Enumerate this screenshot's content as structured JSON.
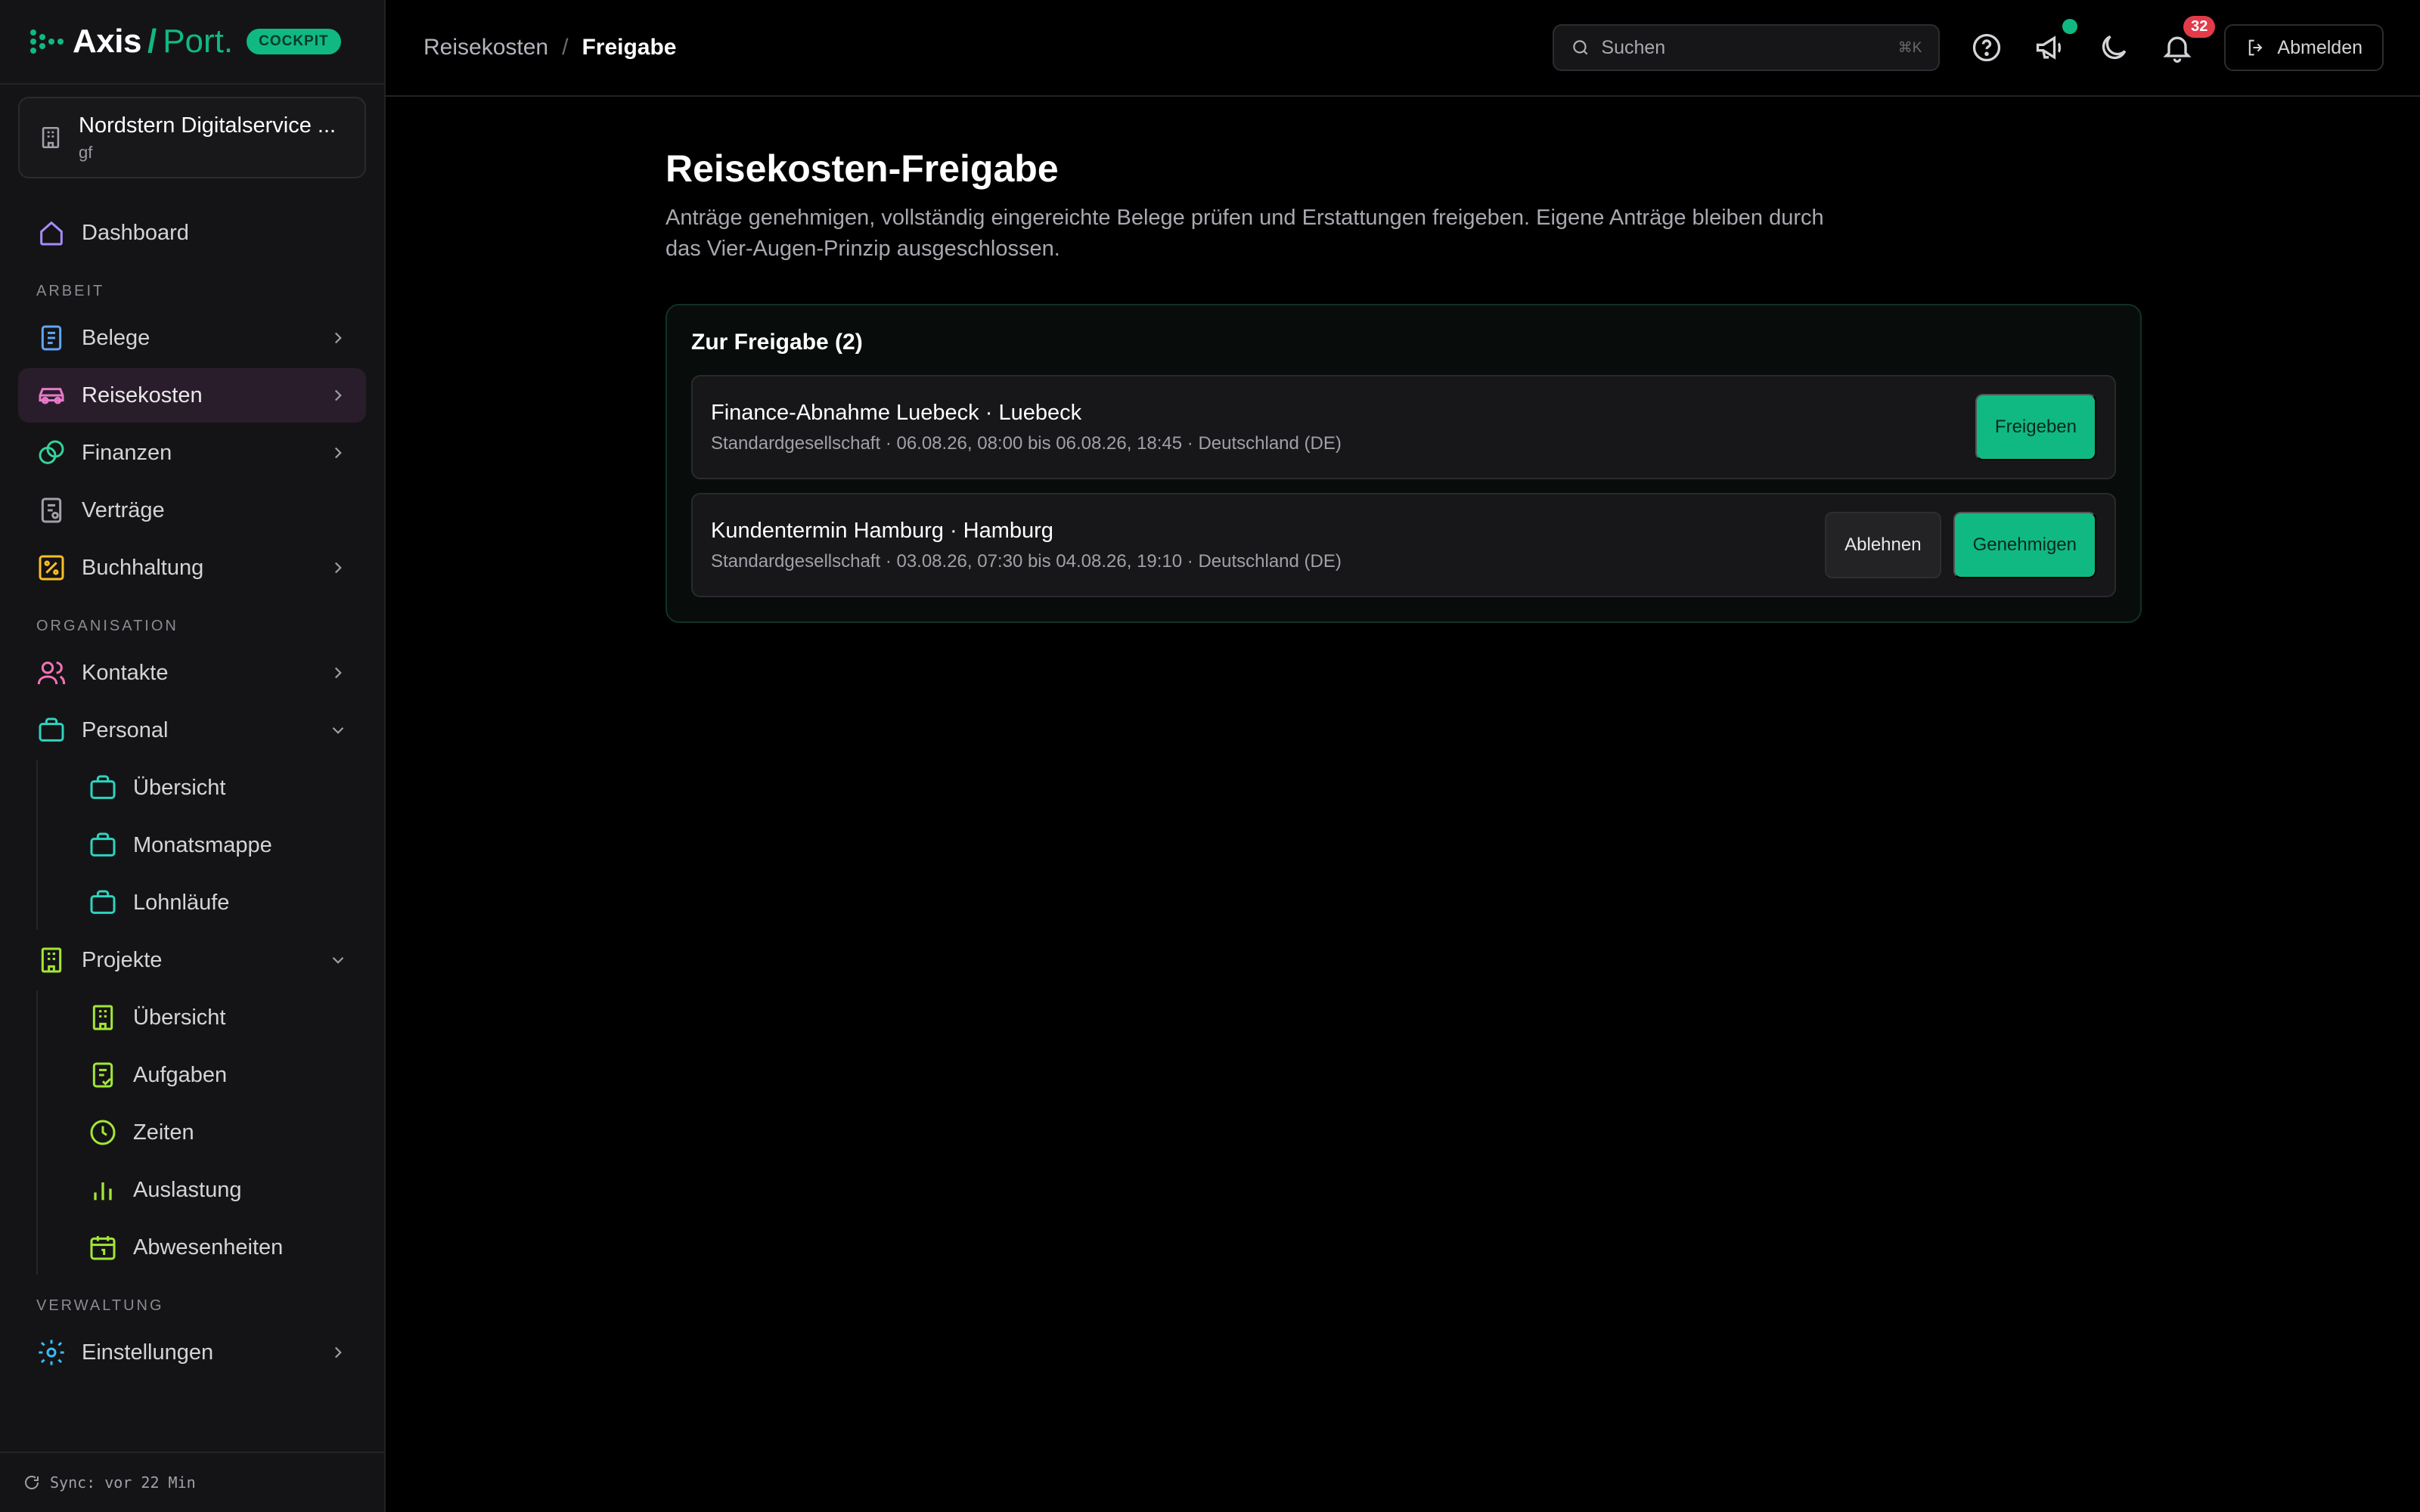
{
  "brand": {
    "name": "Axis",
    "slash": "/",
    "port": "Port.",
    "badge": "COCKPIT"
  },
  "company": {
    "name": "Nordstern Digitalservice ...",
    "subtitle": "gf"
  },
  "sidebar": {
    "dashboard": "Dashboard",
    "section_arbeit": "ARBEIT",
    "belege": "Belege",
    "reisekosten": "Reisekosten",
    "finanzen": "Finanzen",
    "vertraege": "Verträge",
    "buchhaltung": "Buchhaltung",
    "section_organisation": "ORGANISATION",
    "kontakte": "Kontakte",
    "personal": "Personal",
    "personal_sub": [
      "Übersicht",
      "Monatsmappe",
      "Lohnläufe"
    ],
    "projekte": "Projekte",
    "projekte_sub": [
      "Übersicht",
      "Aufgaben",
      "Zeiten",
      "Auslastung",
      "Abwesenheiten"
    ],
    "section_verwaltung": "VERWALTUNG",
    "einstellungen": "Einstellungen",
    "sync": "Sync: vor 22 Min"
  },
  "header": {
    "breadcrumb_parent": "Reisekosten",
    "breadcrumb_sep": "/",
    "breadcrumb_current": "Freigabe",
    "search_placeholder": "Suchen",
    "search_shortcut": "⌘K",
    "notification_count": "32",
    "logout_label": "Abmelden"
  },
  "page": {
    "title": "Reisekosten-Freigabe",
    "description": "Anträge genehmigen, vollständig eingereichte Belege prüfen und Erstattungen freigeben. Eigene Anträge bleiben durch das Vier-Augen-Prinzip ausgeschlossen."
  },
  "panel": {
    "title": "Zur Freigabe (2)",
    "items": [
      {
        "title": "Finance-Abnahme Luebeck · Luebeck",
        "meta": "Standardgesellschaft · 06.08.26, 08:00 bis 06.08.26, 18:45 · Deutschland (DE)",
        "primary_label": "Freigeben"
      },
      {
        "title": "Kundentermin Hamburg · Hamburg",
        "meta": "Standardgesellschaft · 03.08.26, 07:30 bis 04.08.26, 19:10 · Deutschland (DE)",
        "secondary_label": "Ablehnen",
        "primary_label": "Genehmigen"
      }
    ]
  },
  "colors": {
    "accent": "#10b981",
    "background": "#000000",
    "sidebar": "#141416",
    "badge_red": "#e23b4a"
  }
}
